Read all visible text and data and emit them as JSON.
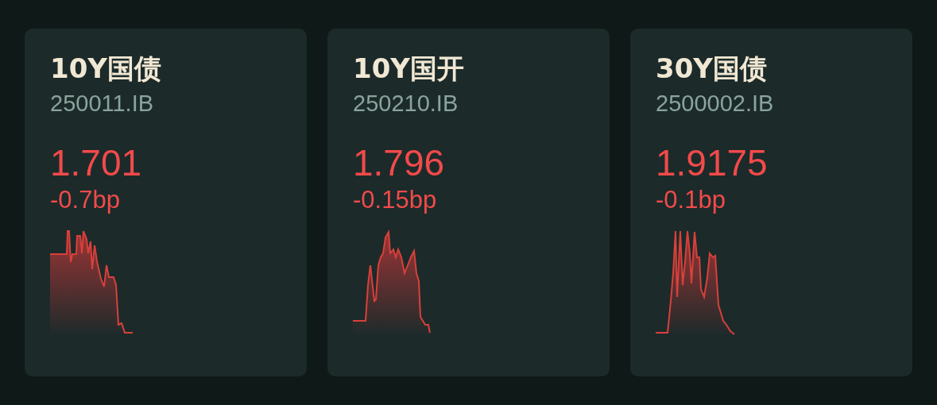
{
  "cards": [
    {
      "name": "10Y国债",
      "code": "250011.IB",
      "yield": "1.701",
      "change": "-0.7bp"
    },
    {
      "name": "10Y国开",
      "code": "250210.IB",
      "yield": "1.796",
      "change": "-0.15bp"
    },
    {
      "name": "30Y国债",
      "code": "2500002.IB",
      "yield": "1.9175",
      "change": "-0.1bp"
    }
  ]
}
